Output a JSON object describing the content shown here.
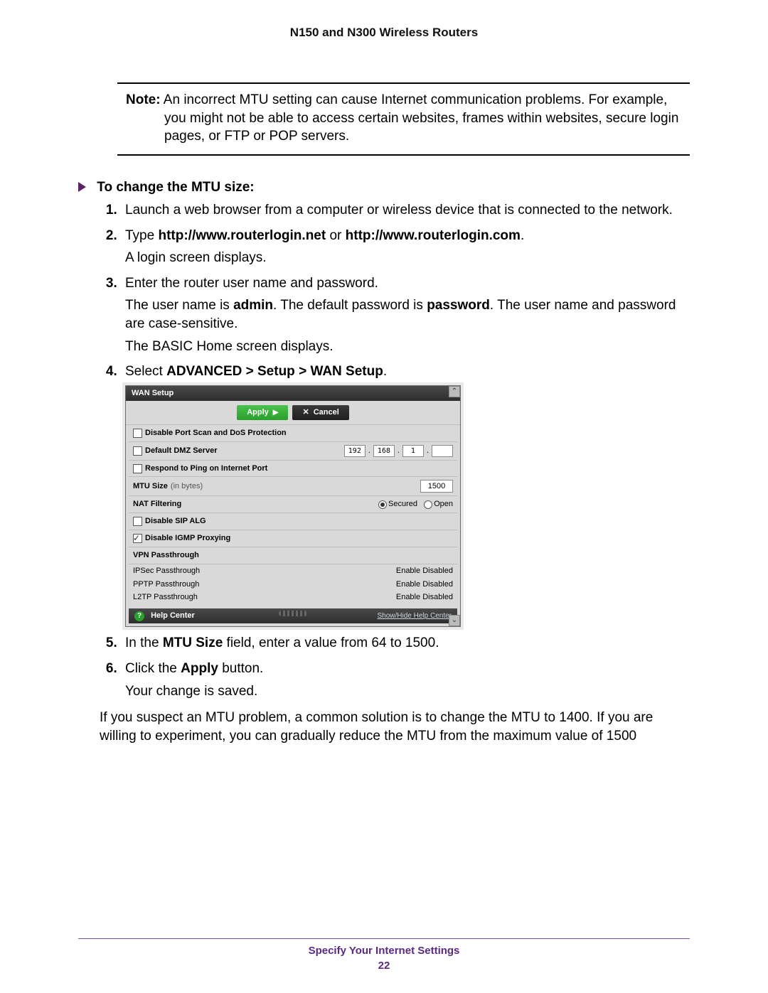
{
  "header": {
    "title": "N150 and N300 Wireless Routers"
  },
  "note": {
    "label": "Note:",
    "text": "An incorrect MTU setting can cause Internet communication problems. For example, you might not be able to access certain websites, frames within websites, secure login pages, or FTP or POP servers."
  },
  "procedure": {
    "heading": "To change the MTU size:",
    "steps": {
      "s1": "Launch a web browser from a computer or wireless device that is connected to the network.",
      "s2_pre": "Type ",
      "s2_b1": "http://www.routerlogin.net",
      "s2_mid": " or ",
      "s2_b2": "http://www.routerlogin.com",
      "s2_post": ".",
      "s2_p2": "A login screen displays.",
      "s3_p1": "Enter the router user name and password.",
      "s3_p2a": "The user name is ",
      "s3_p2b": "admin",
      "s3_p2c": ". The default password is ",
      "s3_p2d": "password",
      "s3_p2e": ". The user name and password are case-sensitive.",
      "s3_p3": "The BASIC Home screen displays.",
      "s4_pre": "Select ",
      "s4_b": "ADVANCED > Setup > WAN Setup",
      "s4_post": ".",
      "s5_a": "In the ",
      "s5_b": "MTU Size",
      "s5_c": " field, enter a value from 64 to 1500.",
      "s6_a": "Click the ",
      "s6_b": "Apply",
      "s6_c": " button.",
      "s6_p": "Your change is saved."
    }
  },
  "trailing": "If you suspect an MTU problem, a common solution is to change the MTU to 1400. If you are willing to experiment, you can gradually reduce the MTU from the maximum value of 1500",
  "router": {
    "title": "WAN Setup",
    "apply": "Apply",
    "cancel": "Cancel",
    "rows": {
      "disable_portscan": "Disable Port Scan and DoS Protection",
      "default_dmz": "Default DMZ Server",
      "dmz_octets": {
        "o1": "192",
        "o2": "168",
        "o3": "1",
        "o4": ""
      },
      "respond_ping": "Respond to Ping on Internet Port",
      "mtu_label_a": "MTU Size ",
      "mtu_label_b": "(in bytes)",
      "mtu_value": "1500",
      "nat_filtering": "NAT Filtering",
      "secured": "Secured",
      "open": "Open",
      "disable_sip": "Disable SIP ALG",
      "disable_igmp": "Disable IGMP Proxying"
    },
    "vpn": {
      "heading": "VPN Passthrough",
      "ipsec": "IPSec Passthrough",
      "pptp": "PPTP Passthrough",
      "l2tp": "L2TP Passthrough",
      "enable": "Enable",
      "disabled": "Disabled"
    },
    "help": {
      "label": "Help Center",
      "show": "Show/Hide Help Center"
    }
  },
  "footer": {
    "section": "Specify Your Internet Settings",
    "page": "22"
  }
}
